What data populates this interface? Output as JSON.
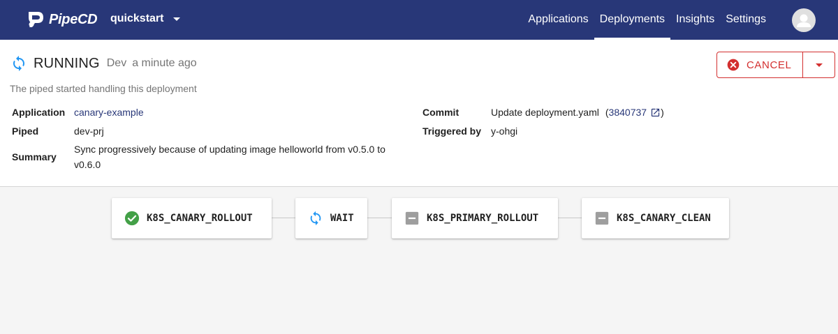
{
  "app": {
    "brand": "PipeCD"
  },
  "topbar": {
    "project": "quickstart",
    "nav": [
      "Applications",
      "Deployments",
      "Insights",
      "Settings"
    ],
    "active_nav": "Deployments"
  },
  "deployment": {
    "status": "RUNNING",
    "env": "Dev",
    "time": "a minute ago",
    "description": "The piped started handling this deployment",
    "labels": {
      "application": "Application",
      "piped": "Piped",
      "summary": "Summary",
      "commit": "Commit",
      "triggered_by": "Triggered by"
    },
    "application": "canary-example",
    "piped": "dev-prj",
    "summary_line1": "Sync progressively because of updating image helloworld from v0.5.0 to",
    "summary_line2": "v0.6.0",
    "commit_message": "Update deployment.yaml",
    "commit_open": "(",
    "commit_hash": "3840737",
    "commit_close": ")",
    "triggered_by": "y-ohgi"
  },
  "actions": {
    "cancel_label": "CANCEL"
  },
  "colors": {
    "appbar": "#283778",
    "success": "#43a047",
    "running": "#2196f3",
    "danger": "#d32f2f",
    "not_started": "#9e9e9e"
  },
  "stages": [
    {
      "name": "K8S_CANARY_ROLLOUT",
      "status": "success",
      "icon": "check-circle-icon"
    },
    {
      "name": "WAIT",
      "status": "running",
      "icon": "sync-icon"
    },
    {
      "name": "K8S_PRIMARY_ROLLOUT",
      "status": "not-started",
      "icon": "minus-square-icon"
    },
    {
      "name": "K8S_CANARY_CLEAN",
      "status": "not-started",
      "icon": "minus-square-icon"
    }
  ]
}
